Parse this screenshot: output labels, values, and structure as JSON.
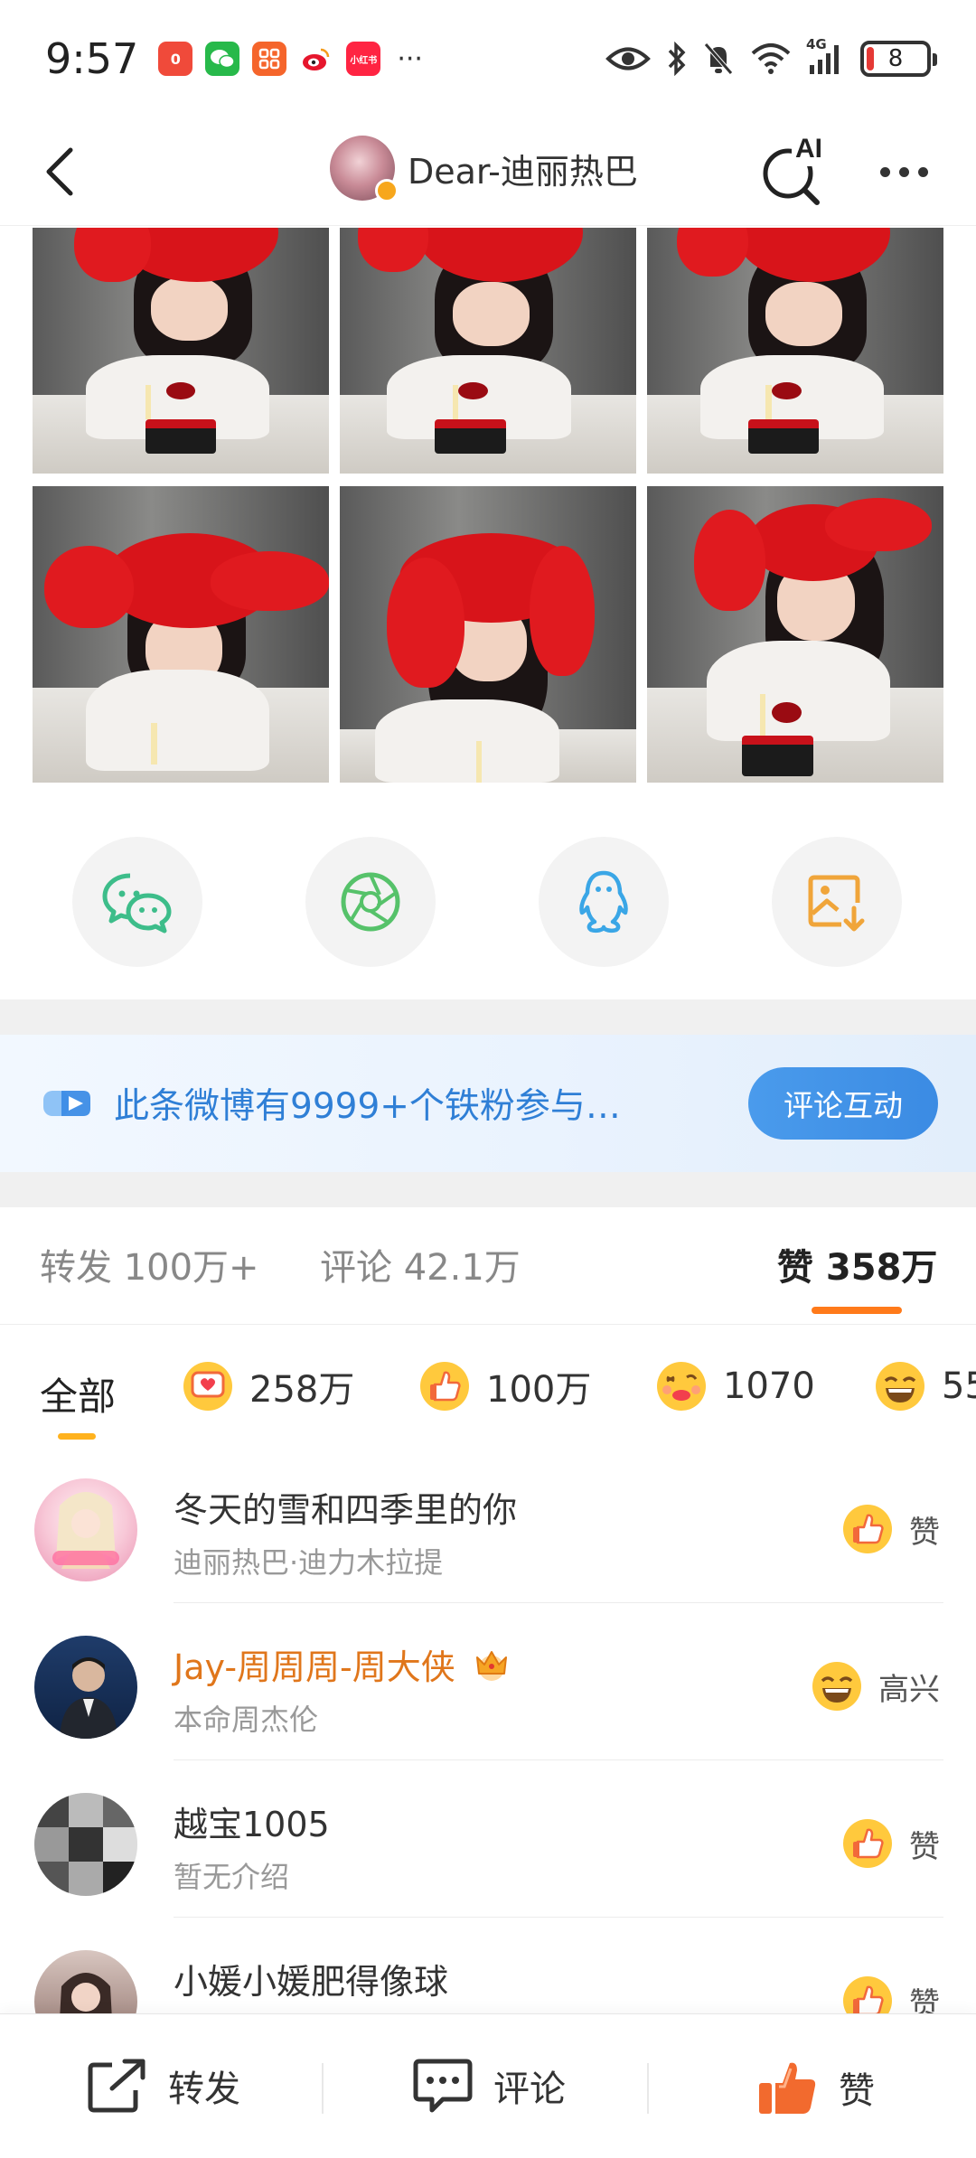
{
  "status_bar": {
    "time": "9:57",
    "apps": [
      {
        "name": "toutiao-app-icon",
        "color": "#f04a3a",
        "glyph": "0"
      },
      {
        "name": "wechat-app-icon",
        "color": "#27b94a",
        "glyph": "W"
      },
      {
        "name": "app-icon",
        "color": "#f5652b",
        "glyph": "88"
      },
      {
        "name": "weibo-app-icon",
        "color": "#ffffff",
        "glyph": "w"
      },
      {
        "name": "xiaohongshu-app-icon",
        "color": "#ff2442",
        "glyph": "小红书"
      }
    ],
    "more": "···",
    "network": "4G",
    "battery": "8"
  },
  "header": {
    "title": "Dear-迪丽热巴",
    "ai_label": "AI"
  },
  "share": {
    "items": [
      "wechat-share",
      "moments-share",
      "qq-share",
      "save-image"
    ]
  },
  "fan_banner": {
    "text": "此条微博有9999+个铁粉参与…",
    "button": "评论互动"
  },
  "stats": {
    "repost": "转发 100万+",
    "comment": "评论 42.1万",
    "like": "赞 358万"
  },
  "reactions": {
    "all": "全部",
    "items": [
      {
        "icon": "heart-face-icon",
        "count": "258万"
      },
      {
        "icon": "thumbs-up-icon",
        "count": "100万"
      },
      {
        "icon": "kiss-face-icon",
        "count": "1070"
      },
      {
        "icon": "happy-face-icon",
        "count": "55"
      }
    ]
  },
  "likes": [
    {
      "name": "冬天的雪和四季里的你",
      "desc": "迪丽热巴·迪力木拉提",
      "reaction": "赞",
      "reaction_icon": "thumbs-up-icon",
      "vip": false
    },
    {
      "name": "Jay-周周周-周大侠",
      "desc": "本命周杰伦",
      "reaction": "高兴",
      "reaction_icon": "happy-face-icon",
      "vip": true
    },
    {
      "name": "越宝1005",
      "desc": "暂无介绍",
      "reaction": "赞",
      "reaction_icon": "thumbs-up-icon",
      "vip": false
    },
    {
      "name": "小媛小媛肥得像球",
      "desc": "",
      "reaction": "赞",
      "reaction_icon": "thumbs-up-icon",
      "vip": false
    }
  ],
  "bottom_bar": {
    "repost": "转发",
    "comment": "评论",
    "like": "赞"
  },
  "colors": {
    "accent_orange": "#ff7a1a",
    "link_blue": "#2f7fd6",
    "vip_orange": "#e0761b"
  }
}
